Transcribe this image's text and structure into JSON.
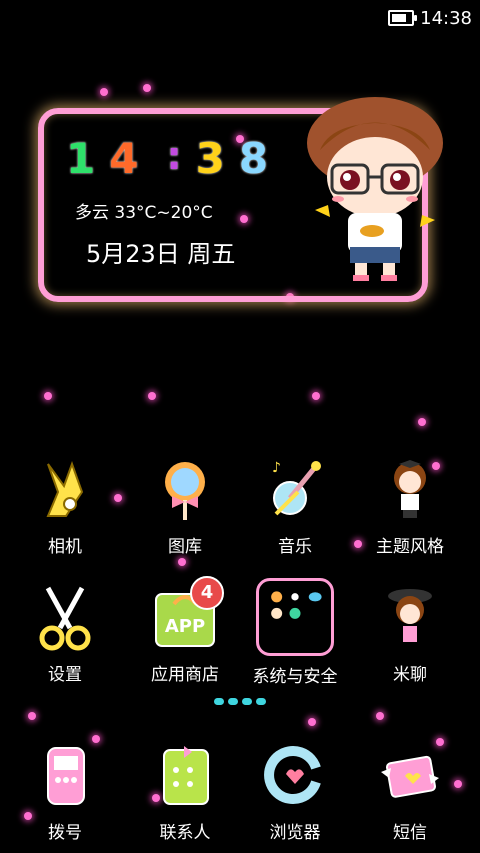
{
  "status_bar": {
    "time": "14:38",
    "battery_level": 0.75
  },
  "widget": {
    "clock_digits": [
      "1",
      "4",
      ":",
      "3",
      "8"
    ],
    "clock_colors": [
      "#2ee06a",
      "#ff6a2a",
      "#c24be0",
      "#ffd21a",
      "#8ad7ff"
    ],
    "weather": "多云 33°C~20°C",
    "date": "5月23日 周五"
  },
  "apps_row1": [
    {
      "label": "相机",
      "icon": "camera-icon"
    },
    {
      "label": "图库",
      "icon": "gallery-icon"
    },
    {
      "label": "音乐",
      "icon": "music-icon"
    },
    {
      "label": "主题风格",
      "icon": "theme-icon"
    }
  ],
  "apps_row2": [
    {
      "label": "设置",
      "icon": "settings-icon"
    },
    {
      "label": "应用商店",
      "icon": "app-store-icon",
      "badge": "4",
      "text": "APP"
    },
    {
      "label": "系统与安全",
      "icon": "folder-icon"
    },
    {
      "label": "米聊",
      "icon": "chat-icon"
    }
  ],
  "dock": [
    {
      "label": "拨号",
      "icon": "phone-icon"
    },
    {
      "label": "联系人",
      "icon": "contacts-icon"
    },
    {
      "label": "浏览器",
      "icon": "browser-icon"
    },
    {
      "label": "短信",
      "icon": "sms-icon"
    }
  ],
  "colors": {
    "accent_pink": "#ff9ed5",
    "dot_pink": "#ff6fd0",
    "page_indicator": "#3fd6e0"
  }
}
